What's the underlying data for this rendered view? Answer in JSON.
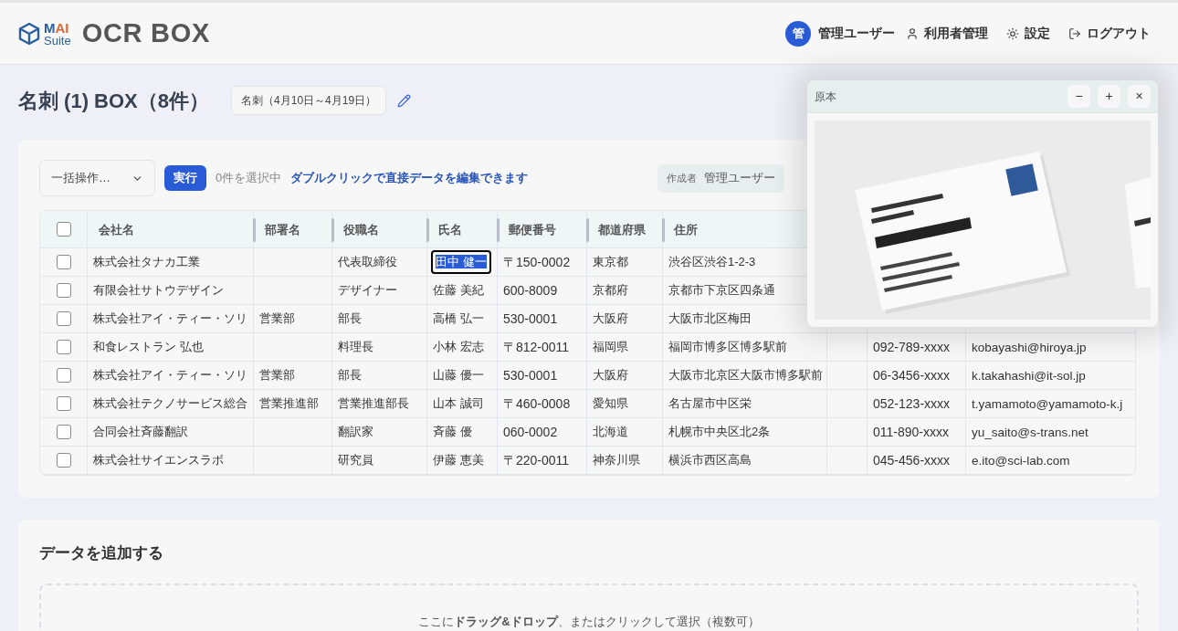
{
  "header": {
    "logo": [
      {
        "text": "M",
        "color": "#2b5f9e"
      },
      {
        "text": "AI",
        "color": "#d8693a"
      }
    ],
    "logo_sub": "Suite",
    "app_title": "OCR BOX",
    "avatar": "管",
    "user": "管理ユーザー",
    "nav": [
      {
        "kind": "user",
        "label": "利用者管理"
      },
      {
        "kind": "settings",
        "label": "設定"
      },
      {
        "kind": "logout",
        "label": "ログアウト"
      }
    ]
  },
  "page": {
    "title": "名刺 (1) BOX（8件）",
    "box_name": "名刺（4月10日～4月19日）"
  },
  "toolbar": {
    "bulk_select": "一括操作…",
    "run": "実行",
    "selected_count": "0件を選択中",
    "hint": "ダブルクリックで直接データを編集できます",
    "creator_label": "作成者",
    "creator": "管理ユーザー"
  },
  "table": {
    "header_checked": false,
    "columns": [
      "会社名",
      "部署名",
      "役職名",
      "氏名",
      "郵便番号",
      "都道府県",
      "住所"
    ],
    "rows": [
      {
        "checked": false,
        "company": "株式会社タナカ工業",
        "department": "",
        "position": "代表取締役",
        "name": "田中 健一",
        "name_editing": true,
        "zip": "〒150-0002",
        "prefecture": "東京都",
        "address": "渋谷区渋谷1-2-3"
      },
      {
        "checked": false,
        "company": "有限会社サトウデザイン",
        "department": "",
        "position": "デザイナー",
        "name": "佐藤 美紀",
        "name_editing": false,
        "zip": "600-8009",
        "prefecture": "京都府",
        "address": "京都市下京区四条通"
      },
      {
        "checked": false,
        "company": "株式会社アイ・ティー・ソリ",
        "department": "営業部",
        "position": "部長",
        "name": "高橋 弘一",
        "name_editing": false,
        "zip": "530-0001",
        "prefecture": "大阪府",
        "address": "大阪市北区梅田"
      },
      {
        "checked": false,
        "company": "和食レストラン 弘也",
        "department": "",
        "position": "料理長",
        "name": "小林 宏志",
        "name_editing": false,
        "zip": "〒812-0011",
        "prefecture": "福岡県",
        "address": "福岡市博多区博多駅前",
        "phone": "092-789-xxxx",
        "email": "kobayashi@hiroya.jp"
      },
      {
        "checked": false,
        "company": "株式会社アイ・ティー・ソリ",
        "department": "営業部",
        "position": "部長",
        "name": "山藤 優一",
        "name_editing": false,
        "zip": "530-0001",
        "prefecture": "大阪府",
        "address": "大阪市北京区大阪市博多駅前",
        "phone": "06-3456-xxxx",
        "email": "k.takahashi@it-sol.jp"
      },
      {
        "checked": false,
        "company": "株式会社テクノサービス総合",
        "department": "営業推進部",
        "position": "営業推進部長",
        "name": "山本 誠司",
        "name_editing": false,
        "zip": "〒460-0008",
        "prefecture": "愛知県",
        "address": "名古屋市中区栄",
        "phone": "052-123-xxxx",
        "email": "t.yamamoto@yamamoto-k.j"
      },
      {
        "checked": false,
        "company": "合同会社斉藤翻訳",
        "department": "",
        "position": "翻訳家",
        "name": "斉藤 優",
        "name_editing": false,
        "zip": "060-0002",
        "prefecture": "北海道",
        "address": "札幌市中央区北2条",
        "phone": "011-890-xxxx",
        "email": "yu_saito@s-trans.net"
      },
      {
        "checked": false,
        "company": "株式会社サイエンスラボ",
        "department": "",
        "position": "研究員",
        "name": "伊藤 恵美",
        "name_editing": false,
        "zip": "〒220-0011",
        "prefecture": "神奈川県",
        "address": "横浜市西区高島",
        "phone": "045-456-xxxx",
        "email": "e.ito@sci-lab.com"
      }
    ]
  },
  "preview_window": {
    "title": "原本",
    "buttons": [
      "−",
      "+",
      "×"
    ]
  },
  "add_data": {
    "title": "データを追加する",
    "dropzone": "ここに**ドラッグ&ドロップ**、またはクリックして選択（複数可）"
  }
}
